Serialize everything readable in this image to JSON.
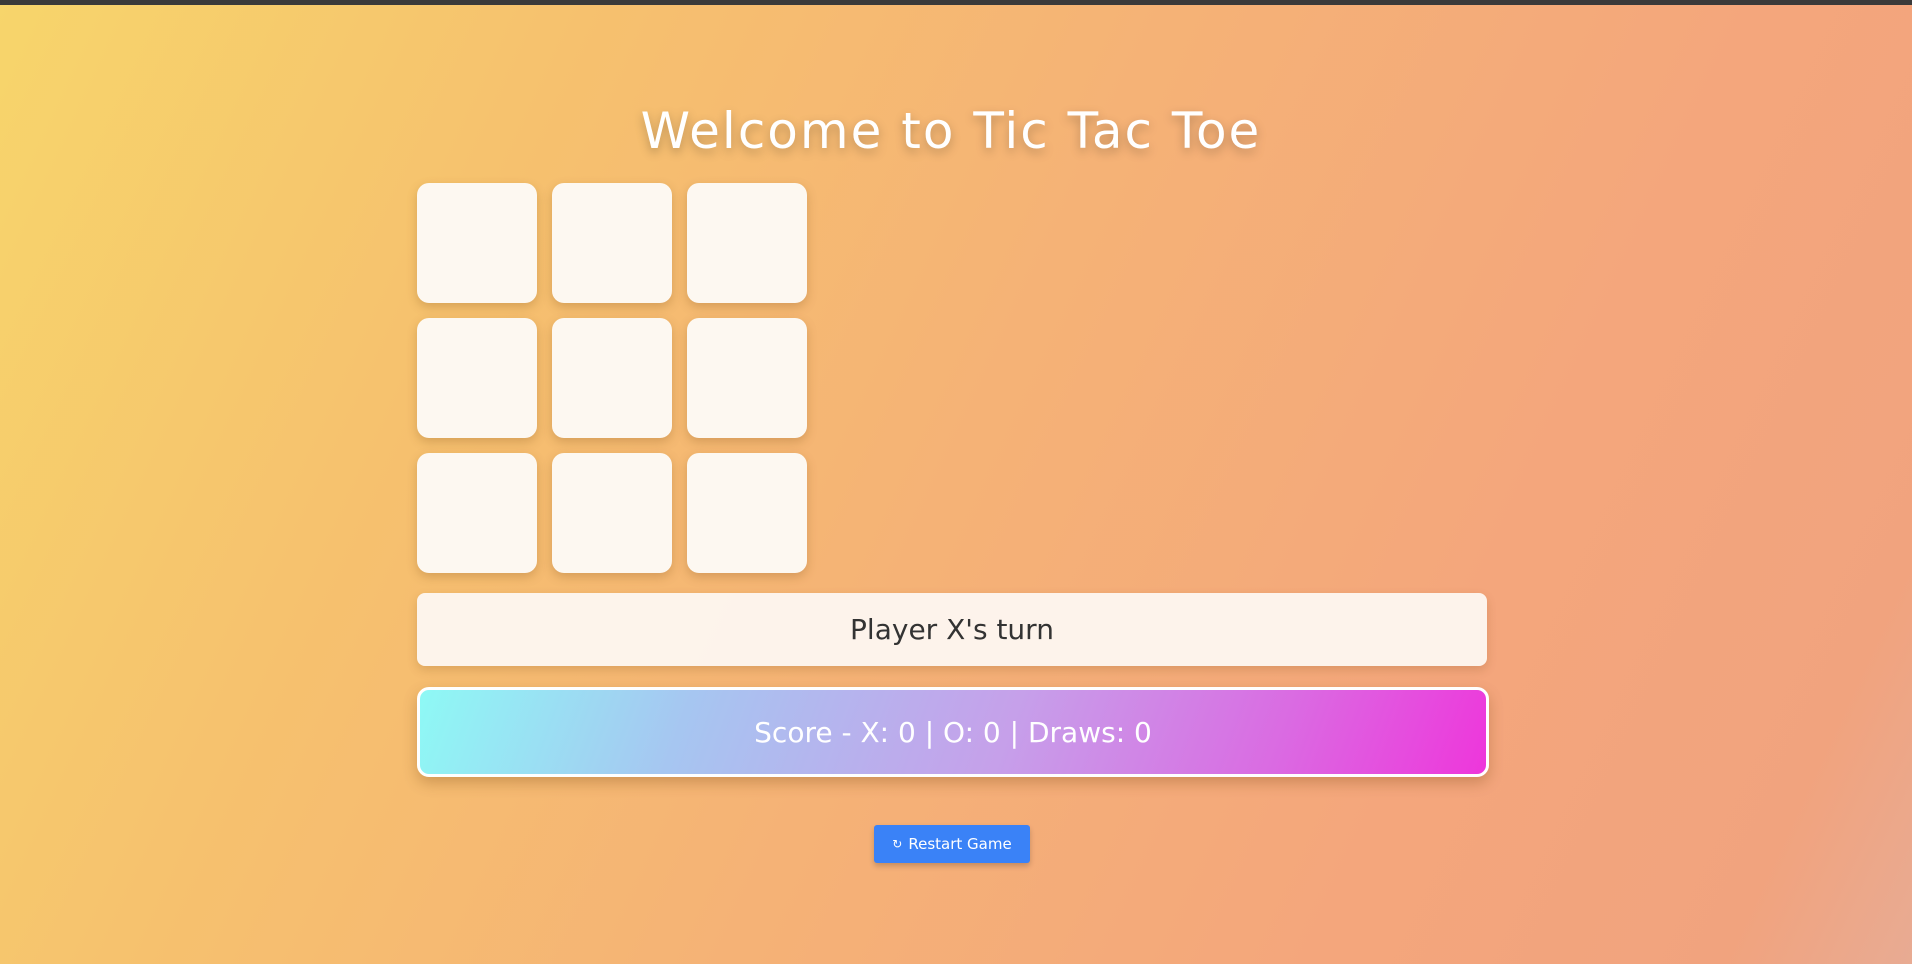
{
  "title": "Welcome to Tic Tac Toe",
  "board": {
    "cells": [
      "",
      "",
      "",
      "",
      "",
      "",
      "",
      "",
      ""
    ]
  },
  "status": "Player X's turn",
  "score": "Score - X: 0 | O: 0 | Draws: 0",
  "restart": {
    "icon": "refresh-icon",
    "icon_glyph": "↻",
    "label": "Restart Game"
  },
  "colors": {
    "accent_button": "#3a82f7",
    "cell_background": "#fdf8f1",
    "score_gradient_start": "#8ef9f5",
    "score_gradient_end": "#ee36db"
  }
}
